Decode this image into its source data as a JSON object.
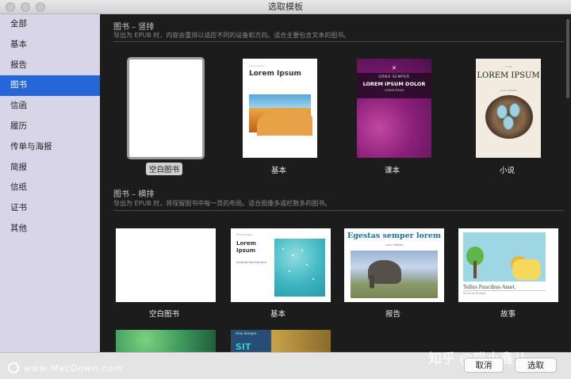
{
  "window": {
    "title": "选取模板"
  },
  "sidebar": {
    "items": [
      {
        "label": "全部"
      },
      {
        "label": "基本"
      },
      {
        "label": "报告"
      },
      {
        "label": "图书",
        "selected": true
      },
      {
        "label": "信函"
      },
      {
        "label": "履历"
      },
      {
        "label": "传单与海报"
      },
      {
        "label": "简报"
      },
      {
        "label": "信纸"
      },
      {
        "label": "证书"
      },
      {
        "label": "其他"
      }
    ]
  },
  "sections": [
    {
      "title": "图书 – 竖排",
      "description": "导出为 EPUB 时，内容会重排以适应不同的设备和方向。适合主要包含文本的图书。",
      "templates": [
        {
          "label": "空白图书",
          "selected": true
        },
        {
          "label": "基本",
          "cover_title": "Lorem Ipsum"
        },
        {
          "label": "课本",
          "cover_kicker": "URNA SEMPER",
          "cover_title": "LOREM IPSUM DOLOR",
          "cover_sub": "LOREM IPSUM"
        },
        {
          "label": "小说",
          "cover_title": "LOREM IPSUM",
          "cover_sub": "URNA SEMPER"
        }
      ]
    },
    {
      "title": "图书 – 横排",
      "description": "导出为 EPUB 时，将保留图书中每一页的布局。适合图像多或栏数多的图书。",
      "templates": [
        {
          "label": "空白图书"
        },
        {
          "label": "基本",
          "cover_small": "Urna Semper",
          "cover_title": "Lorem Ipsum",
          "cover_text": "Incidunt Quo Est Arcu"
        },
        {
          "label": "报告",
          "cover_title": "Egestas semper lorem",
          "cover_sub": "URNA SEMPER"
        },
        {
          "label": "故事",
          "cover_title": "Tellus Faucibus Amet.",
          "cover_sub": "Ad Urna Semper"
        }
      ]
    }
  ],
  "partial_row": {
    "cover_small": "Urna Semper",
    "cover_big": "SIT"
  },
  "footer": {
    "watermark": "www.MacDown.com",
    "overlay": "知乎 @喵小鑫儿",
    "cancel_label": "取消",
    "choose_label": "选取"
  },
  "colors": {
    "sidebar_bg": "#d9d5e8",
    "selection": "#2566d9",
    "main_bg": "#1c1c1c"
  }
}
